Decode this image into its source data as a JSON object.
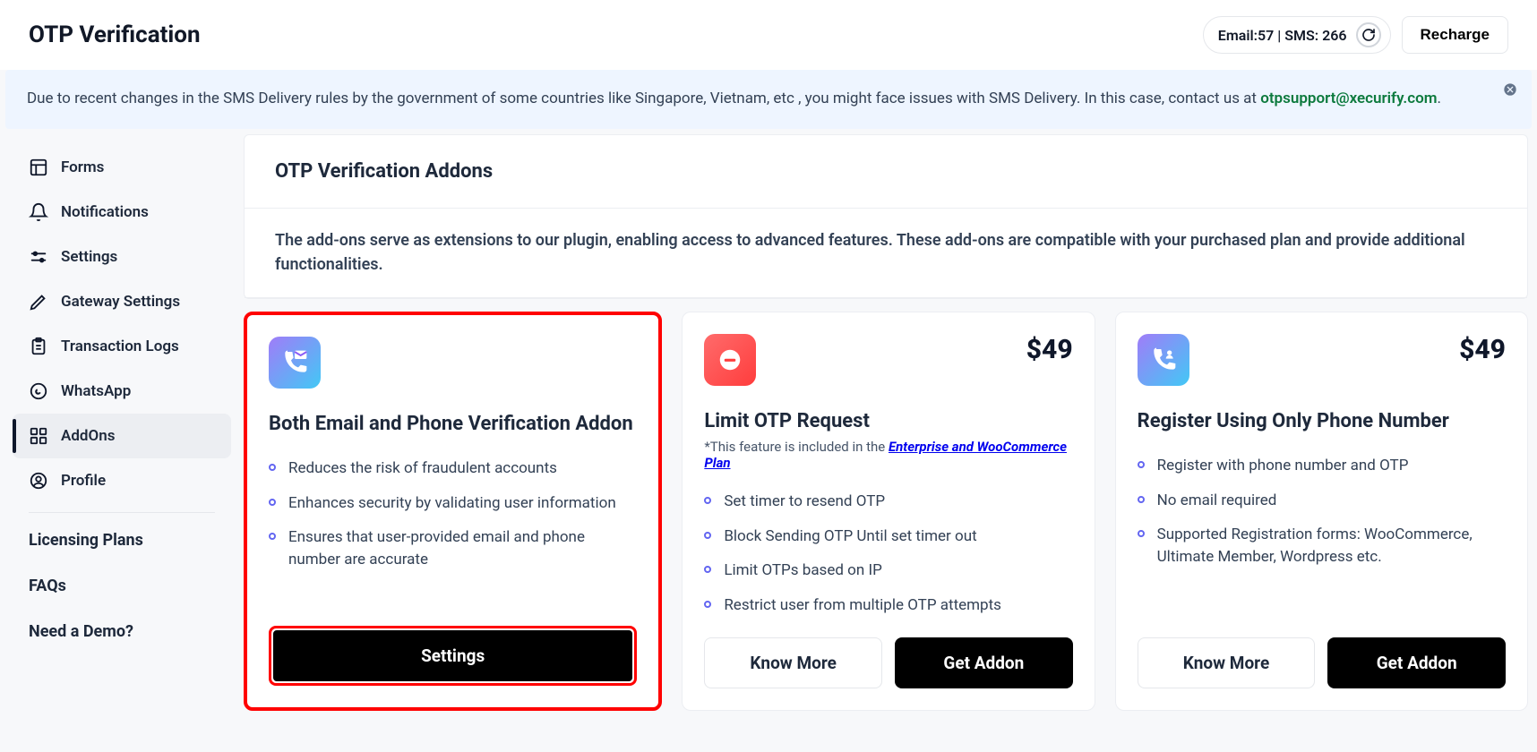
{
  "header": {
    "title": "OTP Verification",
    "credits": "Email:57 | SMS: 266",
    "recharge_label": "Recharge"
  },
  "alert": {
    "text_before": "Due to recent changes in the SMS Delivery rules by the government of some countries like Singapore, Vietnam, etc , you might face issues with SMS Delivery. In this case, contact us at ",
    "email": "otpsupport@xecurify.com",
    "text_after": "."
  },
  "sidebar": {
    "items": [
      {
        "label": "Forms",
        "icon": "layout-icon"
      },
      {
        "label": "Notifications",
        "icon": "bell-icon"
      },
      {
        "label": "Settings",
        "icon": "sliders-icon"
      },
      {
        "label": "Gateway Settings",
        "icon": "pen-icon"
      },
      {
        "label": "Transaction Logs",
        "icon": "clipboard-icon"
      },
      {
        "label": "WhatsApp",
        "icon": "whatsapp-icon"
      },
      {
        "label": "AddOns",
        "icon": "grid-icon",
        "active": true
      },
      {
        "label": "Profile",
        "icon": "user-circle-icon"
      }
    ],
    "links": [
      {
        "label": "Licensing Plans"
      },
      {
        "label": "FAQs"
      },
      {
        "label": "Need a Demo?"
      }
    ]
  },
  "main": {
    "heading": "OTP Verification Addons",
    "description": "The add-ons serve as extensions to our plugin, enabling access to advanced features. These add-ons are compatible with your purchased plan and provide additional functionalities."
  },
  "cards": [
    {
      "title": "Both Email and Phone Verification Addon",
      "price": "",
      "features": [
        "Reduces the risk of fraudulent accounts",
        "Enhances security by validating user information",
        "Ensures that user-provided email and phone number are accurate"
      ],
      "settings_label": "Settings"
    },
    {
      "title": "Limit OTP Request",
      "price": "$49",
      "subtitle_prefix": "*This feature is included in the ",
      "subtitle_link": "Enterprise and WooCommerce Plan",
      "features": [
        "Set timer to resend OTP",
        "Block Sending OTP Until set timer out",
        "Limit OTPs based on IP",
        "Restrict user from multiple OTP attempts"
      ],
      "know_more_label": "Know More",
      "get_addon_label": "Get Addon"
    },
    {
      "title": "Register Using Only Phone Number",
      "price": "$49",
      "features": [
        "Register with phone number and OTP",
        "No email required",
        "Supported Registration forms: WooCommerce, Ultimate Member, Wordpress etc."
      ],
      "know_more_label": "Know More",
      "get_addon_label": "Get Addon"
    }
  ]
}
